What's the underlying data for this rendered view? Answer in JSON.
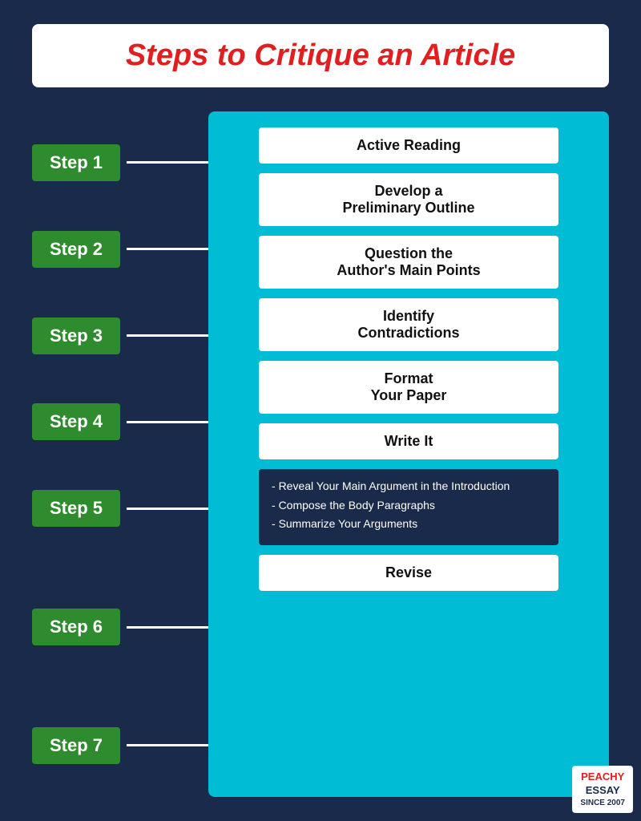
{
  "title": "Steps to Critique an Article",
  "steps": [
    {
      "label": "Step 1",
      "content": "Active Reading",
      "dark": false
    },
    {
      "label": "Step 2",
      "content": "Develop a\nPreliminary Outline",
      "dark": false
    },
    {
      "label": "Step 3",
      "content": "Question the\nAuthor's Main Points",
      "dark": false
    },
    {
      "label": "Step 4",
      "content": "Identify\nContradictions",
      "dark": false
    },
    {
      "label": "Step 5",
      "content": "Format\nYour Paper",
      "dark": false
    },
    {
      "label": "Step 6",
      "content": "Write It",
      "dark": false
    },
    {
      "label": "Step 7",
      "content": "Revise",
      "dark": false
    }
  ],
  "step6_sub": [
    "Reveal Your Main Argument in the Introduction",
    "Compose the Body Paragraphs",
    "Summarize Your Arguments"
  ],
  "watermark": {
    "brand": "PEACHY ESSAY",
    "since": "SINCE 2007"
  }
}
